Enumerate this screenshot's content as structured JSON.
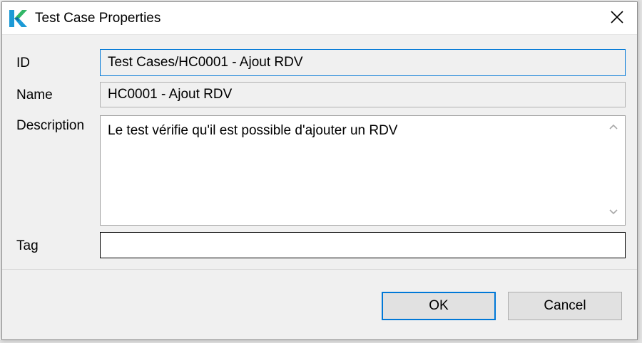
{
  "window": {
    "title": "Test Case Properties",
    "app_icon": "katalon-k-icon",
    "close_icon": "close-icon"
  },
  "form": {
    "id": {
      "label": "ID",
      "value": "Test Cases/HC0001 - Ajout RDV"
    },
    "name": {
      "label": "Name",
      "value": "HC0001 - Ajout RDV"
    },
    "description": {
      "label": "Description",
      "value": "Le test vérifie qu'il est possible d'ajouter un RDV"
    },
    "tag": {
      "label": "Tag",
      "value": ""
    }
  },
  "buttons": {
    "ok": "OK",
    "cancel": "Cancel"
  },
  "colors": {
    "accent": "#0078d7",
    "logo_green": "#32b768",
    "logo_teal": "#1c9ad6"
  }
}
